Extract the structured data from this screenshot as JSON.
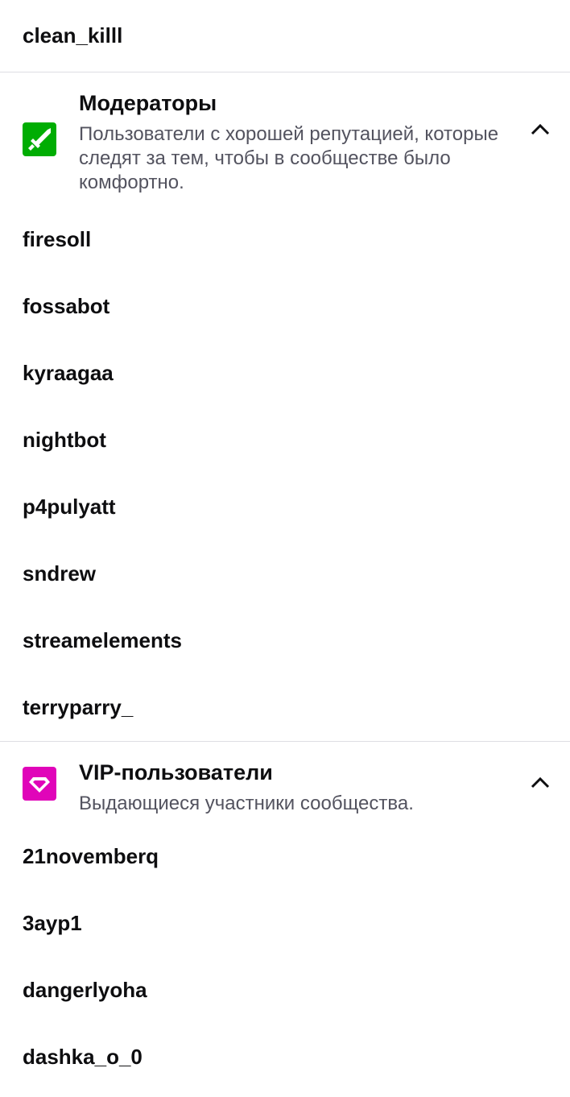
{
  "top_user": "clean_killl",
  "moderators": {
    "title": "Модераторы",
    "description": "Пользователи с хорошей репутацией, которые следят за тем, чтобы в сообществе было комфортно.",
    "badge_icon": "sword-icon",
    "badge_color": "#00ad03",
    "users": [
      "firesoll",
      "fossabot",
      "kyraagaa",
      "nightbot",
      "p4pulyatt",
      "sndrew",
      "streamelements",
      "terryparry_"
    ]
  },
  "vips": {
    "title": "VIP-пользователи",
    "description": "Выдающиеся участники сообщества.",
    "badge_icon": "diamond-icon",
    "badge_color": "#e005b9",
    "users": [
      "21novemberq",
      "3ayp1",
      "dangerlyoha",
      "dashka_o_0"
    ]
  }
}
